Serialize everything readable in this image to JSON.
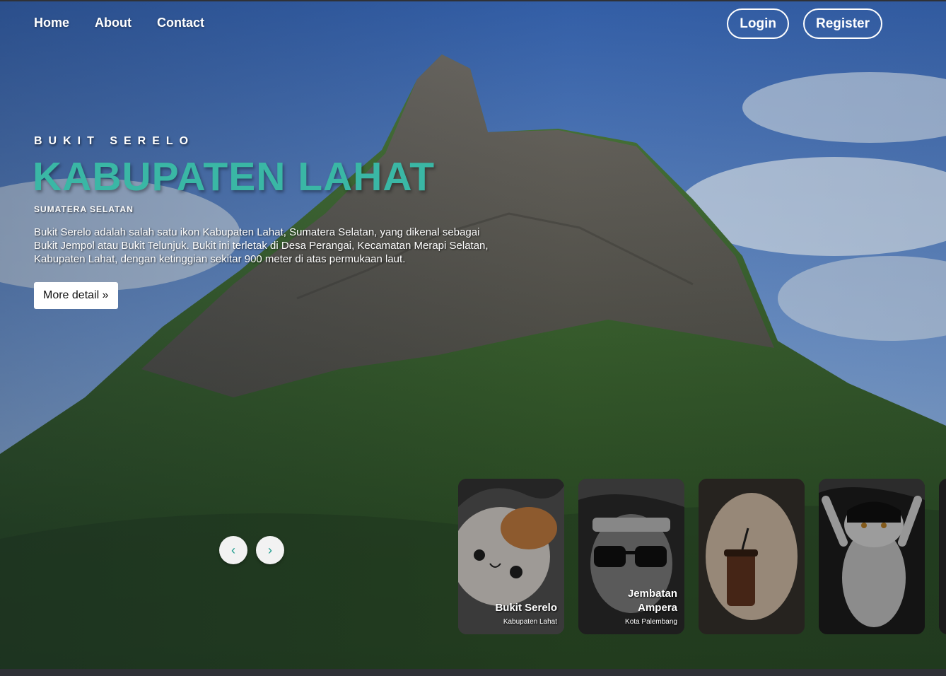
{
  "nav": {
    "home": "Home",
    "about": "About",
    "contact": "Contact"
  },
  "auth": {
    "login": "Login",
    "register": "Register"
  },
  "hero": {
    "eyebrow": "BUKIT SERELO",
    "headline": "KABUPATEN LAHAT",
    "region": "SUMATERA SELATAN",
    "description": "Bukit Serelo adalah salah satu ikon Kabupaten Lahat, Sumatera Selatan, yang dikenal sebagai Bukit Jempol atau Bukit Telunjuk. Bukit ini terletak di Desa Perangai, Kecamatan Merapi Selatan, Kabupaten Lahat, dengan ketinggian sekitar 900 meter di atas permukaan laut.",
    "cta": "More detail »"
  },
  "carousel": {
    "prev_icon": "‹",
    "next_icon": "›",
    "cards": [
      {
        "title": "Bukit Serelo",
        "subtitle": "Kabupaten Lahat"
      },
      {
        "title": "Jembatan Ampera",
        "subtitle": "Kota Palembang"
      },
      {
        "title": "",
        "subtitle": ""
      },
      {
        "title": "",
        "subtitle": ""
      }
    ]
  },
  "colors": {
    "accent": "#3ab7a5",
    "sky": "#3a66b0",
    "forest": "#2f5a2a"
  }
}
